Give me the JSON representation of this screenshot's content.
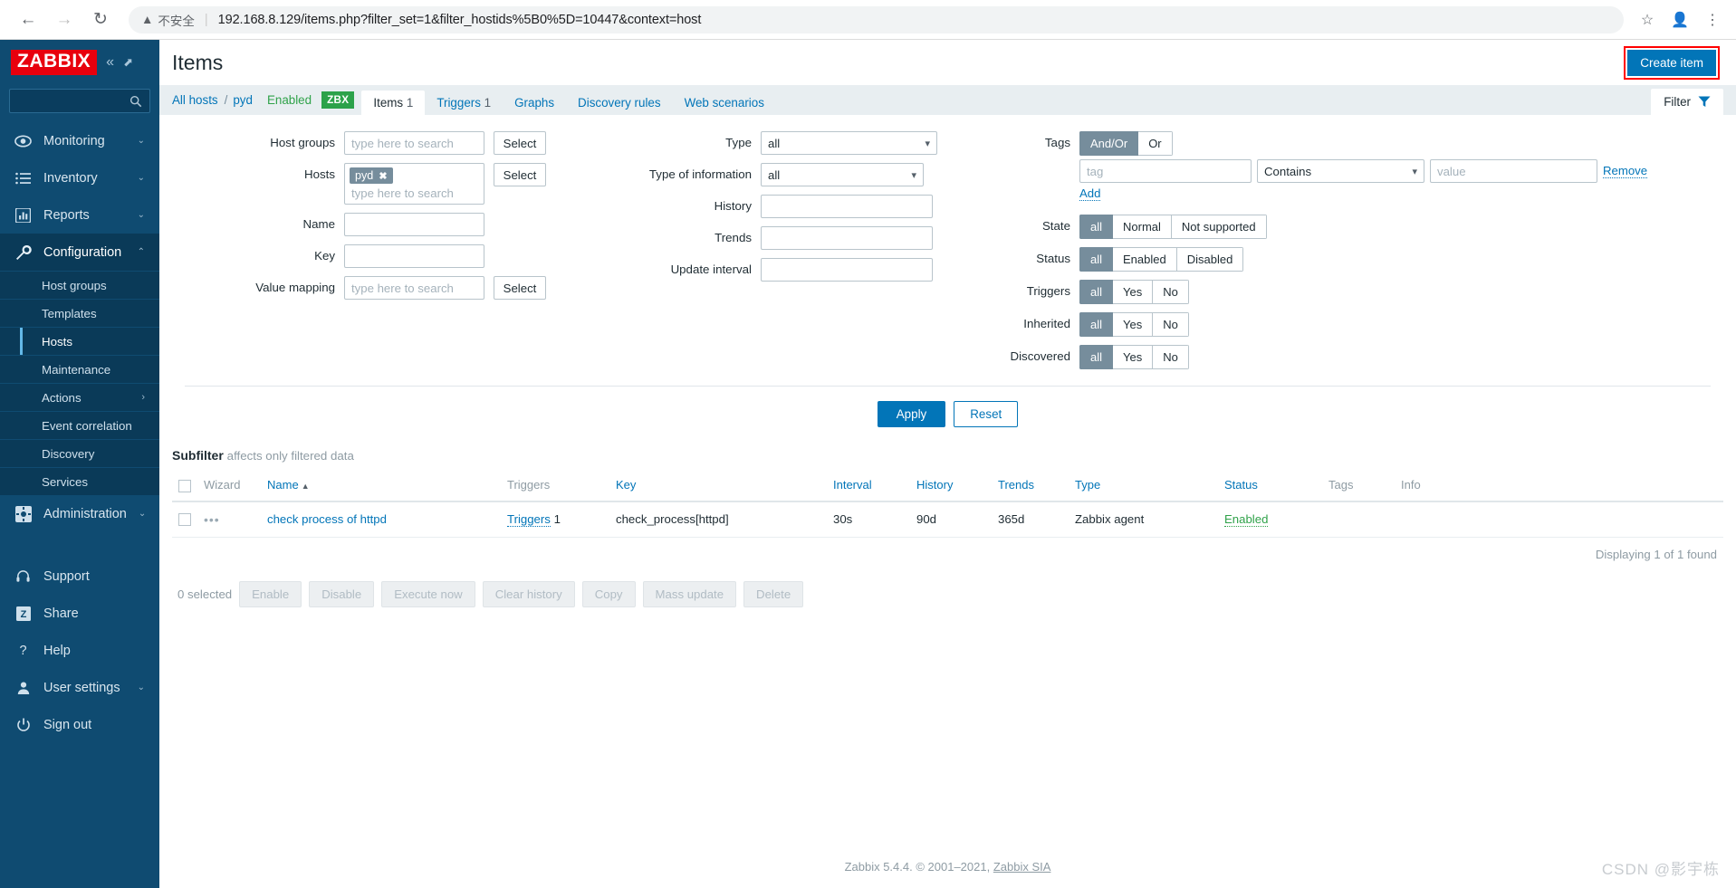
{
  "browser": {
    "back_icon": "back-arrow-icon",
    "forward_icon": "forward-arrow-icon",
    "reload_icon": "reload-icon",
    "security_label": "不安全",
    "url": "192.168.8.129/items.php?filter_set=1&filter_hostids%5B0%5D=10447&context=host",
    "bookmark_icon": "star-icon",
    "profile_icon": "profile-icon",
    "menu_icon": "three-dots-menu-icon"
  },
  "sidebar": {
    "logo": "ZABBIX",
    "collapse_icon": "double-chevron-left-icon",
    "expand_icon": "expand-icon",
    "search_placeholder": "",
    "items": [
      {
        "label": "Monitoring",
        "icon": "eye-icon",
        "chevron": "⌄"
      },
      {
        "label": "Inventory",
        "icon": "list-icon",
        "chevron": "⌄"
      },
      {
        "label": "Reports",
        "icon": "bar-chart-icon",
        "chevron": "⌄"
      },
      {
        "label": "Configuration",
        "icon": "wrench-icon",
        "chevron": "⌃"
      }
    ],
    "submenu": [
      {
        "label": "Host groups"
      },
      {
        "label": "Templates"
      },
      {
        "label": "Hosts"
      },
      {
        "label": "Maintenance"
      },
      {
        "label": "Actions",
        "arrow": "›"
      },
      {
        "label": "Event correlation"
      },
      {
        "label": "Discovery"
      },
      {
        "label": "Services"
      }
    ],
    "administration": {
      "label": "Administration",
      "icon": "gear-icon",
      "chevron": "⌄"
    },
    "bottom": [
      {
        "label": "Support",
        "icon": "headset-icon"
      },
      {
        "label": "Share",
        "icon": "zabbix-share-icon"
      },
      {
        "label": "Help",
        "icon": "question-mark-icon"
      },
      {
        "label": "User settings",
        "icon": "user-icon",
        "chevron": "⌄"
      },
      {
        "label": "Sign out",
        "icon": "power-icon"
      }
    ]
  },
  "header": {
    "title": "Items",
    "create_button": "Create item"
  },
  "breadcrumb": {
    "all_hosts": "All hosts",
    "separator": "/",
    "host": "pyd",
    "status": "Enabled",
    "agent_badge": "ZBX"
  },
  "tabs": [
    {
      "label": "Items",
      "count": "1",
      "active": true
    },
    {
      "label": "Triggers",
      "count": "1",
      "active": false
    },
    {
      "label": "Graphs",
      "count": "",
      "active": false
    },
    {
      "label": "Discovery rules",
      "count": "",
      "active": false
    },
    {
      "label": "Web scenarios",
      "count": "",
      "active": false
    }
  ],
  "filter_tab": {
    "label": "Filter",
    "icon": "funnel-icon"
  },
  "filter": {
    "host_groups": {
      "label": "Host groups",
      "placeholder": "type here to search",
      "value": "",
      "select_button": "Select"
    },
    "hosts": {
      "label": "Hosts",
      "chip": "pyd",
      "placeholder": "type here to search",
      "select_button": "Select"
    },
    "name": {
      "label": "Name",
      "value": ""
    },
    "key": {
      "label": "Key",
      "value": ""
    },
    "value_mapping": {
      "label": "Value mapping",
      "placeholder": "type here to search",
      "value": "",
      "select_button": "Select"
    },
    "type": {
      "label": "Type",
      "value": "all"
    },
    "type_of_information": {
      "label": "Type of information",
      "value": "all"
    },
    "history": {
      "label": "History",
      "value": ""
    },
    "trends": {
      "label": "Trends",
      "value": ""
    },
    "update_interval": {
      "label": "Update interval",
      "value": ""
    },
    "tags": {
      "label": "Tags",
      "mode_options": [
        "And/Or",
        "Or"
      ],
      "mode_selected": "And/Or",
      "tag_placeholder": "tag",
      "operator": "Contains",
      "value_placeholder": "value",
      "remove_link": "Remove",
      "add_link": "Add"
    },
    "state": {
      "label": "State",
      "options": [
        "all",
        "Normal",
        "Not supported"
      ],
      "selected": "all"
    },
    "status": {
      "label": "Status",
      "options": [
        "all",
        "Enabled",
        "Disabled"
      ],
      "selected": "all"
    },
    "triggers": {
      "label": "Triggers",
      "options": [
        "all",
        "Yes",
        "No"
      ],
      "selected": "all"
    },
    "inherited": {
      "label": "Inherited",
      "options": [
        "all",
        "Yes",
        "No"
      ],
      "selected": "all"
    },
    "discovered": {
      "label": "Discovered",
      "options": [
        "all",
        "Yes",
        "No"
      ],
      "selected": "all"
    },
    "apply_button": "Apply",
    "reset_button": "Reset"
  },
  "subfilter": {
    "title": "Subfilter",
    "note": "affects only filtered data"
  },
  "table": {
    "columns": [
      "Wizard",
      "Name",
      "Triggers",
      "Key",
      "Interval",
      "History",
      "Trends",
      "Type",
      "Status",
      "Tags",
      "Info"
    ],
    "sort_column": "Name",
    "sort_arrow": "▲",
    "rows": [
      {
        "wizard": "•••",
        "name": "check process of httpd",
        "triggers_label": "Triggers",
        "triggers_count": "1",
        "key": "check_process[httpd]",
        "interval": "30s",
        "history": "90d",
        "trends": "365d",
        "type": "Zabbix agent",
        "status": "Enabled",
        "tags": "",
        "info": ""
      }
    ],
    "displaying": "Displaying 1 of 1 found"
  },
  "actionbar": {
    "selected_text": "0 selected",
    "buttons": [
      "Enable",
      "Disable",
      "Execute now",
      "Clear history",
      "Copy",
      "Mass update",
      "Delete"
    ]
  },
  "footer": {
    "text": "Zabbix 5.4.4. © 2001–2021,",
    "link": "Zabbix SIA",
    "watermark": "CSDN @影宇栋"
  },
  "colors": {
    "brand_red": "#e8000d",
    "sidebar_bg": "#0f4b71",
    "accent_blue": "#0275b8",
    "green": "#2ca24a",
    "highlight_red": "#ff0000"
  }
}
